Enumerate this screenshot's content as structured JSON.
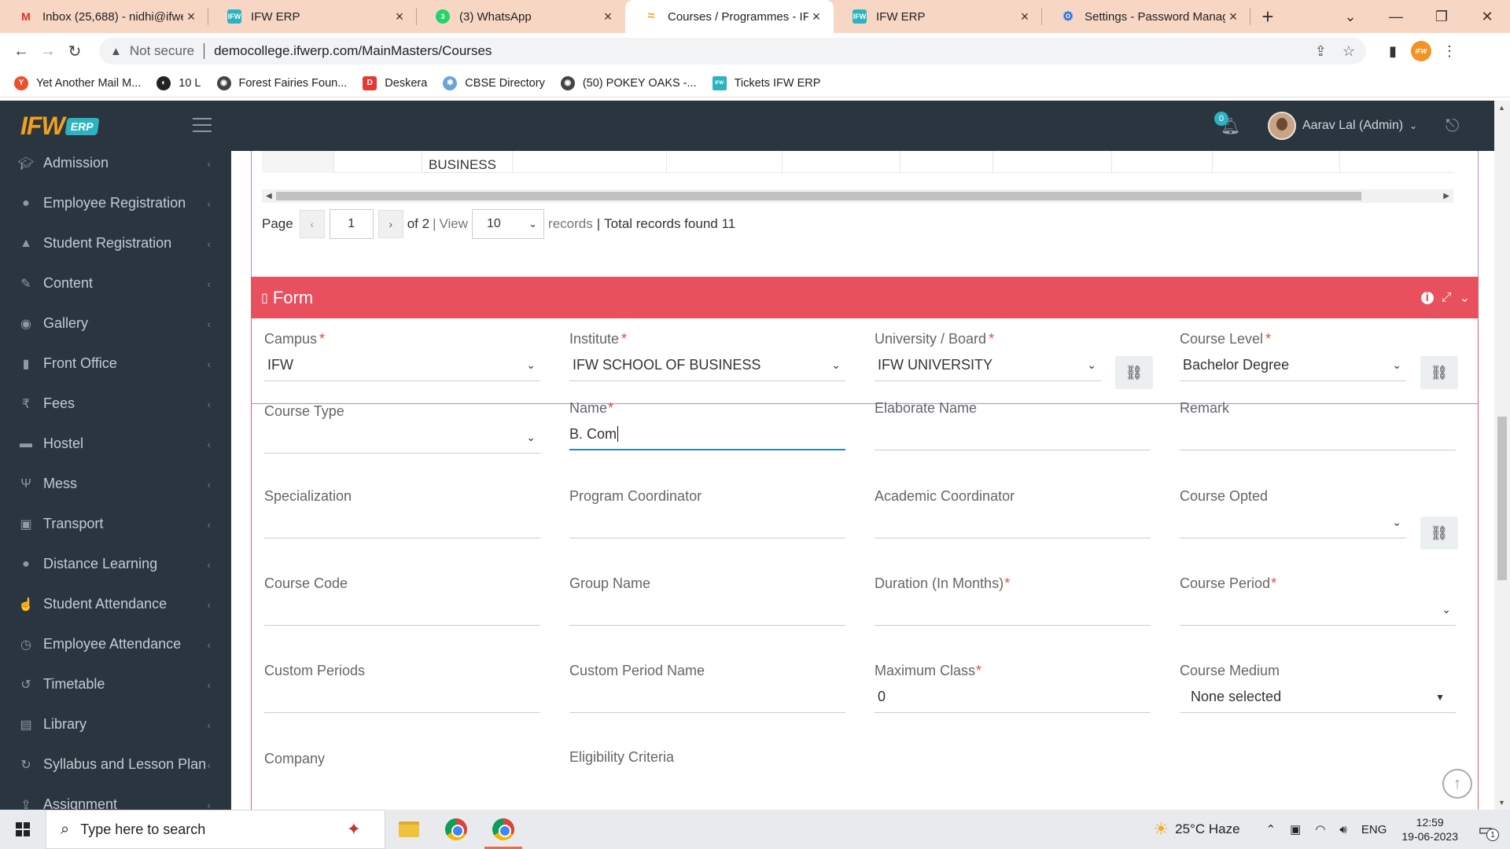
{
  "browser": {
    "tabs": [
      {
        "title": "Inbox (25,688) - nidhi@ifwe",
        "icon": "gmail-icon",
        "favicon_color": "#ffffff",
        "favicon_text": "M"
      },
      {
        "title": "IFW ERP",
        "icon": "ifw-icon",
        "favicon_color": "#2bb3c0",
        "favicon_text": "IFW"
      },
      {
        "title": "(3) WhatsApp",
        "icon": "whatsapp-icon",
        "favicon_color": "#25d366",
        "favicon_text": "3"
      },
      {
        "title": "Courses / Programmes - IFW",
        "icon": "courses-icon",
        "favicon_color": "#f5a623",
        "favicon_text": "~",
        "active": true
      },
      {
        "title": "IFW ERP",
        "icon": "ifw-icon",
        "favicon_color": "#2bb3c0",
        "favicon_text": "IFW"
      },
      {
        "title": "Settings - Password Manag",
        "icon": "settings-gear-icon",
        "favicon_color": "#1a73e8",
        "favicon_text": "⚙"
      }
    ],
    "address": {
      "security_label": "Not secure",
      "url": "democollege.ifwerp.com/MainMasters/Courses"
    },
    "bookmarks": [
      {
        "label": "Yet Another Mail M...",
        "icon": "mail-merge-icon",
        "color": "#e8502f"
      },
      {
        "label": "10 L",
        "icon": "globe-icon",
        "color": "#222222"
      },
      {
        "label": "Forest Fairies Foun...",
        "icon": "eye-icon",
        "color": "#444444"
      },
      {
        "label": "Deskera",
        "icon": "deskera-icon",
        "color": "#e53935"
      },
      {
        "label": "CBSE Directory",
        "icon": "cbse-icon",
        "color": "#6aa5d8"
      },
      {
        "label": "(50) POKEY OAKS -...",
        "icon": "eye-icon",
        "color": "#444444"
      },
      {
        "label": "Tickets IFW ERP",
        "icon": "ifw-icon",
        "color": "#2bb3c0"
      }
    ]
  },
  "header": {
    "logo_text": "IFW",
    "logo_badge": "ERP",
    "notification_count": "0",
    "user_name": "Aarav Lal (Admin)"
  },
  "sidebar": {
    "items": [
      {
        "label": "Admission",
        "icon": "graduation-cap-icon",
        "glyph": "🎓"
      },
      {
        "label": "Employee Registration",
        "icon": "user-icon",
        "glyph": "👤"
      },
      {
        "label": "Student Registration",
        "icon": "graduation-cap-icon",
        "glyph": "🎓"
      },
      {
        "label": "Content",
        "icon": "content-icon",
        "glyph": "✎"
      },
      {
        "label": "Gallery",
        "icon": "camera-icon",
        "glyph": "◉"
      },
      {
        "label": "Front Office",
        "icon": "building-icon",
        "glyph": "▮"
      },
      {
        "label": "Fees",
        "icon": "rupee-icon",
        "glyph": "₹"
      },
      {
        "label": "Hostel",
        "icon": "bed-icon",
        "glyph": "▬"
      },
      {
        "label": "Mess",
        "icon": "cutlery-icon",
        "glyph": "Ψ"
      },
      {
        "label": "Transport",
        "icon": "bus-icon",
        "glyph": "▣"
      },
      {
        "label": "Distance Learning",
        "icon": "globe-icon",
        "glyph": "●"
      },
      {
        "label": "Student Attendance",
        "icon": "hand-icon",
        "glyph": "✋"
      },
      {
        "label": "Employee Attendance",
        "icon": "clock-icon",
        "glyph": "◷"
      },
      {
        "label": "Timetable",
        "icon": "history-icon",
        "glyph": "↺"
      },
      {
        "label": "Library",
        "icon": "book-icon",
        "glyph": "▤"
      },
      {
        "label": "Syllabus and Lesson Plan",
        "icon": "refresh-icon",
        "glyph": "↻"
      },
      {
        "label": "Assignment",
        "icon": "upload-icon",
        "glyph": "⇪"
      }
    ]
  },
  "grid": {
    "visible_cell": "BUSINESS",
    "pager": {
      "page_label": "Page",
      "current_page": "1",
      "of_label": "of 2",
      "view_label": "View",
      "page_size": "10",
      "records_label": "records",
      "total_label": "Total records found 11"
    }
  },
  "form": {
    "title": "Form",
    "fields": {
      "campus": {
        "label": "Campus",
        "value": "IFW",
        "required": true
      },
      "institute": {
        "label": "Institute",
        "value": "IFW SCHOOL OF BUSINESS",
        "required": true
      },
      "university": {
        "label": "University / Board",
        "value": "IFW UNIVERSITY",
        "required": true
      },
      "course_level": {
        "label": "Course Level",
        "value": "Bachelor Degree",
        "required": true
      },
      "course_type": {
        "label": "Course Type",
        "value": ""
      },
      "name": {
        "label": "Name",
        "value": "B. Com",
        "required": true
      },
      "elaborate_name": {
        "label": "Elaborate Name",
        "value": ""
      },
      "remark": {
        "label": "Remark",
        "value": ""
      },
      "specialization": {
        "label": "Specialization",
        "value": ""
      },
      "program_coordinator": {
        "label": "Program Coordinator",
        "value": ""
      },
      "academic_coordinator": {
        "label": "Academic Coordinator",
        "value": ""
      },
      "course_opted": {
        "label": "Course Opted",
        "value": ""
      },
      "course_code": {
        "label": "Course Code",
        "value": ""
      },
      "group_name": {
        "label": "Group Name",
        "value": ""
      },
      "duration": {
        "label": "Duration (In Months)",
        "value": "",
        "required": true
      },
      "course_period": {
        "label": "Course Period",
        "value": "",
        "required": true
      },
      "custom_periods": {
        "label": "Custom Periods",
        "value": ""
      },
      "custom_period_name": {
        "label": "Custom Period Name",
        "value": ""
      },
      "maximum_class": {
        "label": "Maximum Class",
        "value": "0",
        "required": true
      },
      "course_medium": {
        "label": "Course Medium",
        "value": "None selected"
      },
      "company": {
        "label": "Company",
        "value": ""
      },
      "eligibility": {
        "label": "Eligibility Criteria",
        "value": ""
      }
    },
    "required_marker": "*"
  },
  "taskbar": {
    "search_placeholder": "Type here to search",
    "weather": "25°C  Haze",
    "language": "ENG",
    "time": "12:59",
    "date": "19-06-2023",
    "notification_count": "1"
  },
  "colors": {
    "header_bg": "#2b3540",
    "form_accent": "#e8505e",
    "grid_border": "#b48ac8",
    "focus_blue": "#2b86c5",
    "tab_strip": "#f8d6c4"
  }
}
